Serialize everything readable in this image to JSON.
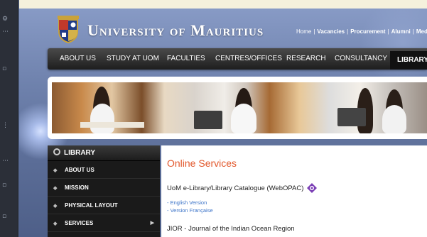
{
  "header": {
    "university_name": "University of Mauritius",
    "top_links": [
      {
        "label": "Home",
        "bold": false
      },
      {
        "label": "Vacancies",
        "bold": true
      },
      {
        "label": "Procurement",
        "bold": true
      },
      {
        "label": "Alumni",
        "bold": true
      },
      {
        "label": "Media",
        "bold": true
      }
    ]
  },
  "nav": {
    "items": [
      "ABOUT US",
      "STUDY AT UOM",
      "FACULTIES",
      "CENTRES/OFFICES",
      "RESEARCH",
      "CONSULTANCY",
      "LIBRARY"
    ],
    "active": "LIBRARY"
  },
  "sidebar": {
    "heading": "LIBRARY",
    "items": [
      {
        "label": "ABOUT US",
        "has_submenu": false
      },
      {
        "label": "MISSION",
        "has_submenu": false
      },
      {
        "label": "PHYSICAL LAYOUT",
        "has_submenu": false
      },
      {
        "label": "SERVICES",
        "has_submenu": true
      }
    ]
  },
  "content": {
    "title": "Online Services",
    "webopac_label": "UoM e-Library/Library Catalogue (WebOPAC)",
    "links": [
      "- English Version",
      "- Version Française"
    ],
    "next_item": "JIOR - Journal of the Indian Ocean Region"
  },
  "colors": {
    "accent": "#e2572b",
    "link": "#3b73c8",
    "nav_bg": "#1e1e1e"
  }
}
